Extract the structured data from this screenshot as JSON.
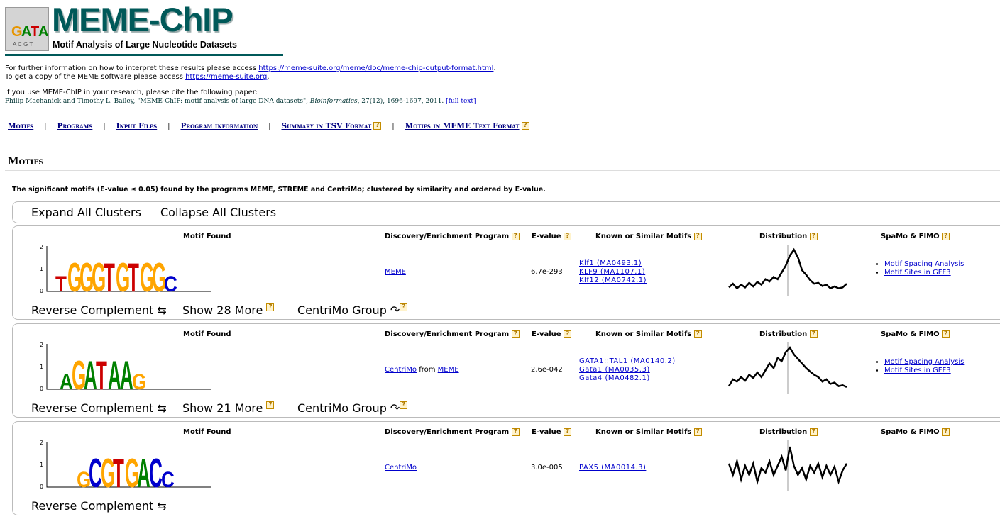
{
  "header": {
    "title": "MEME-ChIP",
    "subtitle": "Motif Analysis of Large Nucleotide Datasets"
  },
  "info": {
    "line1_prefix": "For further information on how to interpret these results please access ",
    "line1_link": "https://meme-suite.org/meme/doc/meme-chip-output-format.html",
    "line1_suffix": ".",
    "line2_prefix": "To get a copy of the MEME software please access ",
    "line2_link": "https://meme-suite.org",
    "line2_suffix": ".",
    "cite_intro": "If you use MEME-ChIP in your research, please cite the following paper:",
    "cite_authors": "Philip Machanick and Timothy L. Bailey, \"MEME-ChIP: motif analysis of large DNA datasets\", ",
    "cite_journal": "Bioinformatics",
    "cite_details": ", 27(12), 1696-1697, 2011. ",
    "cite_fulltext": "[full text]"
  },
  "nav": {
    "motifs": "Motifs",
    "programs": "Programs",
    "input_files": "Input Files",
    "program_information": "Program information",
    "summary_tsv": "Summary in TSV Format",
    "motifs_meme_text": "Motifs in MEME Text Format",
    "separator": "|"
  },
  "section": {
    "title": "Motifs",
    "description": "The significant motifs (E-value ≤ 0.05) found by the programs MEME, STREME and CentriMo; clustered by similarity and ordered by E-value."
  },
  "cluster_controls": {
    "expand": "Expand All Clusters",
    "collapse": "Collapse All Clusters"
  },
  "columns": {
    "motif_found": "Motif Found",
    "program": "Discovery/Enrichment Program",
    "evalue": "E-value",
    "known": "Known or Similar Motifs",
    "distribution": "Distribution",
    "spamo": "SpaMo & FIMO"
  },
  "help_glyph": "?",
  "motifs": [
    {
      "program_link": "MEME",
      "program_from": "",
      "program_from_link": "",
      "evalue": "6.7e-293",
      "known": [
        "Klf1 (MA0493.1)",
        "KLF9 (MA1107.1)",
        "Klf12 (MA0742.1)"
      ],
      "spamo": [
        "Motif Spacing Analysis",
        "Motif Sites in GFF3"
      ],
      "reverse": "Reverse Complement ⇆",
      "show_more": "Show 28 More ",
      "centrimo": "CentriMo Group ↷",
      "logo_letters": "TGGGTGTGGC",
      "distribution": [
        0.12,
        0.2,
        0.1,
        0.18,
        0.12,
        0.22,
        0.14,
        0.24,
        0.18,
        0.3,
        0.25,
        0.35,
        0.3,
        0.45,
        0.6,
        0.82,
        0.95,
        0.78,
        0.5,
        0.4,
        0.28,
        0.2,
        0.22,
        0.15,
        0.18,
        0.1,
        0.14,
        0.1,
        0.12,
        0.2
      ]
    },
    {
      "program_link": "CentriMo",
      "program_from": " from ",
      "program_from_link": "MEME",
      "evalue": "2.6e-042",
      "known": [
        "GATA1::TAL1 (MA0140.2)",
        "Gata1 (MA0035.3)",
        "Gata4 (MA0482.1)"
      ],
      "spamo": [
        "Motif Spacing Analysis",
        "Motif Sites in GFF3"
      ],
      "reverse": "Reverse Complement ⇆",
      "show_more": "Show 21 More ",
      "centrimo": "CentriMo Group ↷",
      "logo_letters": "AGATAAG",
      "distribution": [
        0.1,
        0.25,
        0.2,
        0.3,
        0.22,
        0.35,
        0.28,
        0.4,
        0.3,
        0.45,
        0.6,
        0.5,
        0.72,
        0.65,
        0.85,
        0.95,
        0.8,
        0.7,
        0.6,
        0.5,
        0.42,
        0.35,
        0.3,
        0.2,
        0.25,
        0.15,
        0.18,
        0.1,
        0.12,
        0.08
      ]
    },
    {
      "program_link": "CentriMo",
      "program_from": "",
      "program_from_link": "",
      "evalue": "3.0e-005",
      "known": [
        "PAX5 (MA0014.3)"
      ],
      "spamo": [],
      "reverse": "Reverse Complement ⇆",
      "show_more": "",
      "centrimo": "",
      "logo_letters": "GCGTGACC",
      "distribution": [
        0.55,
        0.3,
        0.6,
        0.2,
        0.5,
        0.3,
        0.55,
        0.15,
        0.45,
        0.35,
        0.6,
        0.3,
        0.5,
        0.7,
        0.4,
        0.92,
        0.5,
        0.3,
        0.45,
        0.2,
        0.5,
        0.35,
        0.55,
        0.25,
        0.5,
        0.3,
        0.48,
        0.15,
        0.4,
        0.55
      ]
    }
  ]
}
